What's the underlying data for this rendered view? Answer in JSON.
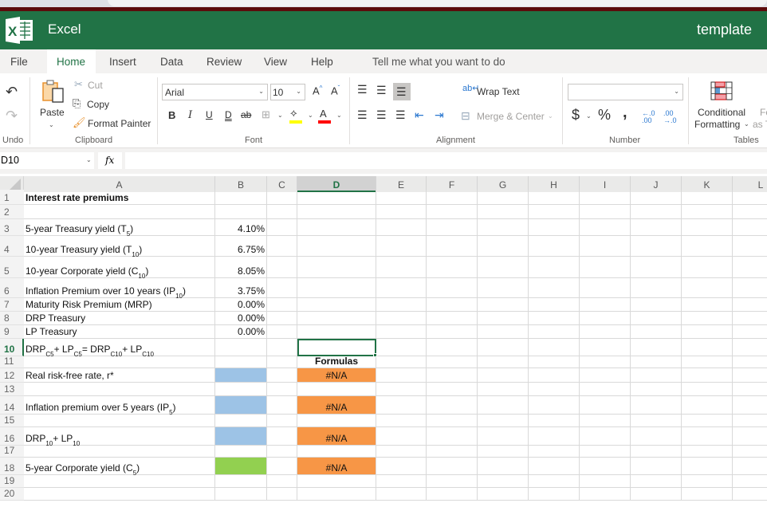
{
  "app": {
    "name": "Excel",
    "document_title": "template"
  },
  "tabs": [
    {
      "label": "File",
      "active": false
    },
    {
      "label": "Home",
      "active": true
    },
    {
      "label": "Insert",
      "active": false
    },
    {
      "label": "Data",
      "active": false
    },
    {
      "label": "Review",
      "active": false
    },
    {
      "label": "View",
      "active": false
    },
    {
      "label": "Help",
      "active": false
    }
  ],
  "tell_me": "Tell me what you want to do",
  "ribbon": {
    "undo": {
      "group_label": "Undo"
    },
    "clipboard": {
      "group_label": "Clipboard",
      "paste": "Paste",
      "cut": "Cut",
      "copy": "Copy",
      "format_painter": "Format Painter"
    },
    "font": {
      "group_label": "Font",
      "font_name": "Arial",
      "font_size": "10",
      "bold": "B",
      "italic": "I",
      "underline": "U",
      "double_underline": "D",
      "strikethrough": "ab",
      "fill_color": "#ffff00",
      "font_color": "#ff0000"
    },
    "alignment": {
      "group_label": "Alignment",
      "wrap_text": "Wrap Text",
      "merge_center": "Merge & Center"
    },
    "number": {
      "group_label": "Number",
      "format_value": "",
      "currency": "$",
      "percent": "%",
      "comma": ","
    },
    "tables": {
      "group_label": "Tables",
      "conditional_formatting_line1": "Conditional",
      "conditional_formatting_line2": "Formatting",
      "format_as_table_line1": "Fo",
      "format_as_table_line2": "as T"
    }
  },
  "formula_bar": {
    "name_box": "D10",
    "fx": "fx",
    "formula": ""
  },
  "sheet": {
    "columns": [
      "A",
      "B",
      "C",
      "D",
      "E",
      "F",
      "G",
      "H",
      "I",
      "J",
      "K",
      "L"
    ],
    "selected_column": "D",
    "selected_row": "10",
    "rows": [
      {
        "num": "1",
        "a": "Interest rate premiums",
        "b": "",
        "d": ""
      },
      {
        "num": "2",
        "a": "",
        "b": "",
        "d": ""
      },
      {
        "num": "3",
        "a": "5-year Treasury yield (T",
        "a_sub": "5",
        "a_end": ")",
        "b": "4.10%",
        "d": ""
      },
      {
        "num": "4",
        "a": "10-year Treasury yield (T",
        "a_sub": "10",
        "a_end": ")",
        "b": "6.75%",
        "d": ""
      },
      {
        "num": "5",
        "a": "10-year Corporate yield (C",
        "a_sub": "10",
        "a_end": ")",
        "b": "8.05%",
        "d": ""
      },
      {
        "num": "6",
        "a": "Inflation Premium over 10 years (IP",
        "a_sub": "10",
        "a_end": ")",
        "b": "3.75%",
        "d": ""
      },
      {
        "num": "7",
        "a": "Maturity Risk Premium (MRP)",
        "b": "0.00%",
        "d": ""
      },
      {
        "num": "8",
        "a": "DRP Treasury",
        "b": "0.00%",
        "d": ""
      },
      {
        "num": "9",
        "a": "LP Treasury",
        "b": "0.00%",
        "d": ""
      },
      {
        "num": "10",
        "a_parts": [
          "DRP",
          "C5",
          " + LP",
          "C5",
          " = DRP",
          "C10",
          " + LP",
          "C10"
        ],
        "b": "",
        "d": ""
      },
      {
        "num": "11",
        "a": "",
        "b": "",
        "d": "Formulas"
      },
      {
        "num": "12",
        "a": "Real risk-free rate, r*",
        "b": "",
        "d": "#N/A"
      },
      {
        "num": "13",
        "a": "",
        "b": "",
        "d": ""
      },
      {
        "num": "14",
        "a": "Inflation premium over 5 years (IP",
        "a_sub": "5",
        "a_end": ")",
        "b": "",
        "d": "#N/A"
      },
      {
        "num": "15",
        "a": "",
        "b": "",
        "d": ""
      },
      {
        "num": "16",
        "a_parts": [
          "DRP",
          "10",
          " + LP",
          "10"
        ],
        "b": "",
        "d": "#N/A"
      },
      {
        "num": "17",
        "a": "",
        "b": "",
        "d": ""
      },
      {
        "num": "18",
        "a": "5-year Corporate yield (C",
        "a_sub": "5",
        "a_end": ")",
        "b": "",
        "d": "#N/A"
      },
      {
        "num": "19",
        "a": "",
        "b": "",
        "d": ""
      },
      {
        "num": "20",
        "a": "",
        "b": "",
        "d": ""
      }
    ],
    "fill_colors": {
      "input_blue": "#9dc3e6",
      "input_green": "#92d050",
      "formula_orange": "#f79646"
    }
  }
}
